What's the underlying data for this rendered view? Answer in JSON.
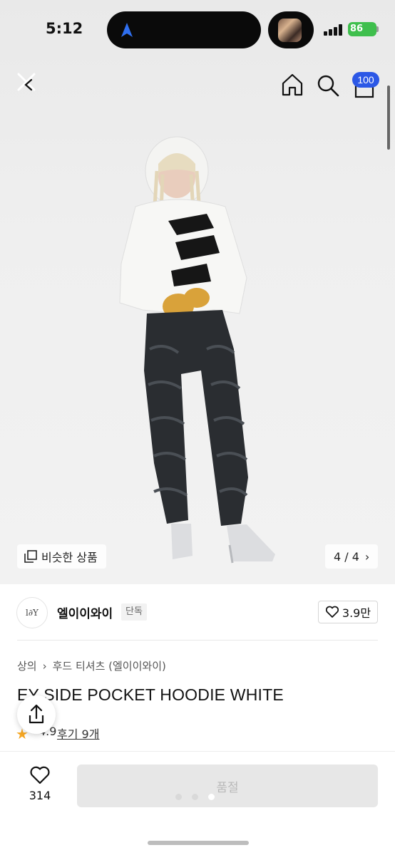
{
  "status_bar": {
    "time": "5:12",
    "battery": "86"
  },
  "nav": {
    "cart_count": "100"
  },
  "image": {
    "similar_label": "비슷한 상품",
    "page_counter": "4 / 4"
  },
  "brand": {
    "logo_text": "l∂Y",
    "name": "엘이이와이",
    "tag": "단독",
    "likes": "3.9만"
  },
  "product": {
    "breadcrumb": [
      "상의",
      "후드 티셔츠 (엘이이와이)"
    ],
    "title": "EY SIDE POCKET HOODIE WHITE",
    "rating": "4.9",
    "reviews": "후기 9개"
  },
  "bottom_bar": {
    "like_count": "314",
    "buy_label": "품절"
  },
  "icons": [
    "close-icon",
    "home-icon",
    "search-icon",
    "cart-icon",
    "similar-items-icon",
    "chevron-right-icon",
    "heart-icon",
    "share-icon",
    "star-icon"
  ],
  "colors": {
    "badge": "#2c58e6",
    "battery": "#3fbf4d",
    "star": "#f5a623",
    "soldout_bg": "#e7e7e7"
  }
}
